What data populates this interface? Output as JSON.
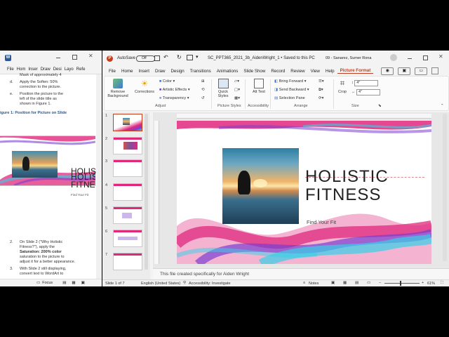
{
  "word": {
    "menu": [
      "File",
      "Hom",
      "Inser",
      "Draw",
      "Desi",
      "Layo",
      "Refe"
    ],
    "lines": {
      "top": "Mask of approximately 4",
      "d_num": "d.",
      "d_text1": "Apply the Soften: 50%",
      "d_text2": "correction to the picture.",
      "e_num": "e.",
      "e_text1": "Position the picture to the",
      "e_text2": "left of the slide title as",
      "e_text3": "shown in Figure 1.",
      "figure": "igure 1: Position for Picture on Slide",
      "fig_title1": "HOLIS",
      "fig_title2": "FITNE",
      "fig_sub": "Find Your Fit",
      "n2": "2.",
      "s2_1": "On Slide 2 (\"Why Holistic",
      "s2_2": "Fitness?\"), apply the",
      "s2_3": "Saturation: 200% color",
      "s2_4": "saturation to the picture to",
      "s2_5": "adjust it for a better appearance.",
      "n3": "3.",
      "s3_1": "With Slide 2 still displaying,",
      "s3_2": "convert text to WordArt to"
    },
    "status": {
      "focus": "Focus"
    }
  },
  "ppt": {
    "autosave": "AutoSave",
    "autosave_state": "Off",
    "doc_title": "SC_PPT365_2021_3b_AidenWright_1 • Saved to this PC",
    "user": "09 - Sanarez, Sumer Rona",
    "tabs": [
      "File",
      "Home",
      "Insert",
      "Draw",
      "Design",
      "Transitions",
      "Animations",
      "Slide Show",
      "Record",
      "Review",
      "View",
      "Help",
      "Picture Format"
    ],
    "ribbon": {
      "remove_bg": "Remove Background",
      "corrections": "Corrections",
      "color": "Color",
      "artistic": "Artistic Effects",
      "transparency": "Transparency",
      "adjust": "Adjust",
      "quick_styles": "Quick Styles",
      "picture_styles": "Picture Styles",
      "alt_text": "Alt Text",
      "accessibility": "Accessibility",
      "bring_forward": "Bring Forward",
      "send_backward": "Send Backward",
      "selection_pane": "Selection Pane",
      "arrange": "Arrange",
      "crop": "Crop",
      "height": "4\"",
      "width": "4\"",
      "size": "Size"
    },
    "thumbs": [
      "1",
      "2",
      "3",
      "4",
      "5",
      "6",
      "7"
    ],
    "slide": {
      "title1": "HOLISTIC",
      "title2": "FITNESS",
      "subtitle": "Find Your Fit"
    },
    "notes": "This file created specifically for Aiden Wright",
    "status": {
      "slide": "Slide 1 of 7",
      "language": "English (United States)",
      "accessibility": "Accessibility: Investigate",
      "notes": "Notes",
      "zoom": "61%"
    }
  },
  "colors": {
    "accent": "#c43e1c",
    "pink": "#e0287c",
    "purple": "#7a3fd0",
    "cyan": "#36d0e8"
  }
}
